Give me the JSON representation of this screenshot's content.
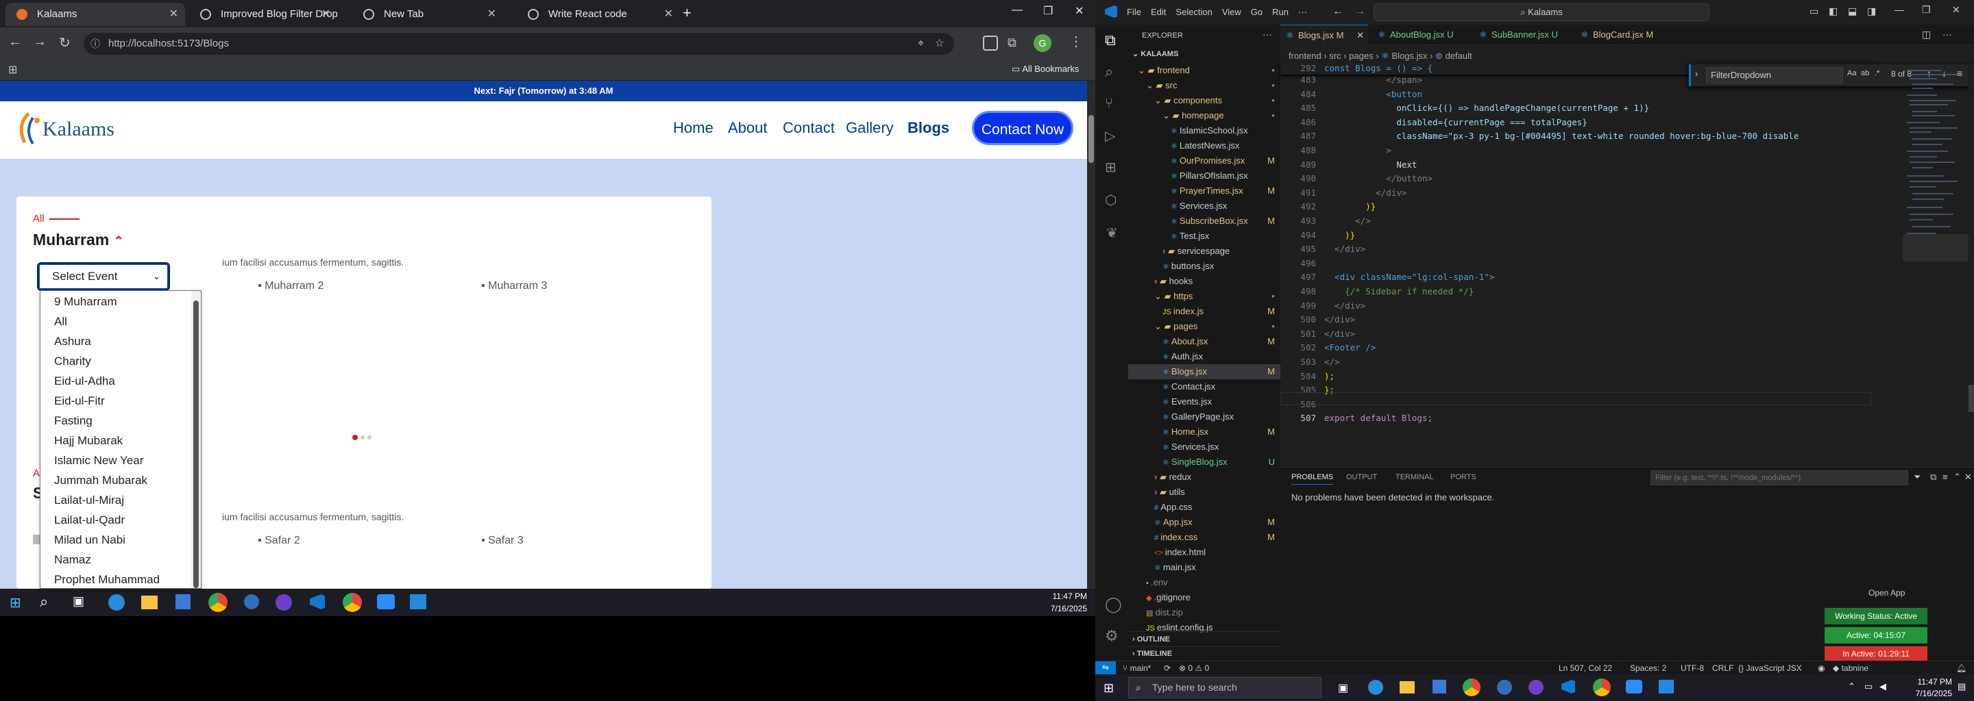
{
  "browser": {
    "tabs": [
      {
        "title": "Kalaams",
        "color": "#ef6c2e"
      },
      {
        "title": "Improved Blog Filter Dropdown",
        "color": "#c4c7c5"
      },
      {
        "title": "New Tab",
        "color": "#c4c7c5"
      },
      {
        "title": "Write React code",
        "color": "#c4c7c5"
      }
    ],
    "url": "http://localhost:5173/Blogs",
    "bookmarks_label": "All Bookmarks"
  },
  "site": {
    "notice": "Next: Fajr (Tomorrow) at 3:48 AM",
    "logo_text": "Kalaams",
    "nav": [
      "Home",
      "About",
      "Contact",
      "Gallery",
      "Blogs"
    ],
    "cta": "Contact Now",
    "category_tag": "All",
    "section_title": "Muharram",
    "select_value": "Select Event",
    "dropdown_options": [
      "9 Muharram",
      "All",
      "Ashura",
      "Charity",
      "Eid-ul-Adha",
      "Eid-ul-Fitr",
      "Fasting",
      "Hajj Mubarak",
      "Islamic New Year",
      "Jummah Mubarak",
      "Lailat-ul-Miraj",
      "Lailat-ul-Qadr",
      "Milad un Nabi",
      "Namaz",
      "Prophet Muhammad (PBUH)"
    ],
    "excerpt": "ium facilisi accusamus fermentum, sagittis.",
    "images_row1": [
      "Muharram 2",
      "Muharram 3"
    ],
    "second_tag": "A",
    "second_title": "S",
    "excerpt2": "ium facilisi accusamus fermentum, sagittis.",
    "images_row2": [
      "Safar 2",
      "Safar 3"
    ]
  },
  "win_taskbar_left": {
    "time": "11:47 PM",
    "date": "7/16/2025"
  },
  "vscode": {
    "menu": [
      "File",
      "Edit",
      "Selection",
      "View",
      "Go",
      "Run",
      "···"
    ],
    "search": "Kalaams",
    "explorer_title": "EXPLORER",
    "root": "KALAAMS",
    "tree": [
      {
        "name": "frontend",
        "depth": 0,
        "folder": true,
        "open": true,
        "dot": true
      },
      {
        "name": "src",
        "depth": 1,
        "folder": true,
        "open": true,
        "dot": true
      },
      {
        "name": "components",
        "depth": 2,
        "folder": true,
        "open": true,
        "dot": true
      },
      {
        "name": "homepage",
        "depth": 3,
        "folder": true,
        "open": true,
        "dot": true
      },
      {
        "name": "IslamicSchool.jsx",
        "depth": 4,
        "status": ""
      },
      {
        "name": "LatestNews.jsx",
        "depth": 4,
        "status": ""
      },
      {
        "name": "OurPromises.jsx",
        "depth": 4,
        "status": "M"
      },
      {
        "name": "PillarsOfIslam.jsx",
        "depth": 4,
        "status": ""
      },
      {
        "name": "PrayerTimes.jsx",
        "depth": 4,
        "status": "M"
      },
      {
        "name": "Services.jsx",
        "depth": 4,
        "status": ""
      },
      {
        "name": "SubscribeBox.jsx",
        "depth": 4,
        "status": "M"
      },
      {
        "name": "Test.jsx",
        "depth": 4,
        "status": ""
      },
      {
        "name": "servicespage",
        "depth": 3,
        "folder": true,
        "open": false
      },
      {
        "name": "buttons.jsx",
        "depth": 3,
        "status": ""
      },
      {
        "name": "hooks",
        "depth": 2,
        "folder": true,
        "open": false
      },
      {
        "name": "https",
        "depth": 2,
        "folder": true,
        "open": true,
        "dot": true
      },
      {
        "name": "index.js",
        "depth": 3,
        "status": "M"
      },
      {
        "name": "pages",
        "depth": 2,
        "folder": true,
        "open": true,
        "dot": true
      },
      {
        "name": "About.jsx",
        "depth": 3,
        "status": "M"
      },
      {
        "name": "Auth.jsx",
        "depth": 3,
        "status": ""
      },
      {
        "name": "Blogs.jsx",
        "depth": 3,
        "status": "M",
        "selected": true
      },
      {
        "name": "Contact.jsx",
        "depth": 3,
        "status": ""
      },
      {
        "name": "Events.jsx",
        "depth": 3,
        "status": ""
      },
      {
        "name": "GalleryPage.jsx",
        "depth": 3,
        "status": ""
      },
      {
        "name": "Home.jsx",
        "depth": 3,
        "status": "M"
      },
      {
        "name": "Services.jsx",
        "depth": 3,
        "status": ""
      },
      {
        "name": "SingleBlog.jsx",
        "depth": 3,
        "status": "U"
      },
      {
        "name": "redux",
        "depth": 2,
        "folder": true,
        "open": false
      },
      {
        "name": "utils",
        "depth": 2,
        "folder": true,
        "open": false
      },
      {
        "name": "App.css",
        "depth": 2,
        "status": ""
      },
      {
        "name": "App.jsx",
        "depth": 2,
        "status": "M"
      },
      {
        "name": "index.css",
        "depth": 2,
        "status": "M"
      },
      {
        "name": "index.html",
        "depth": 2,
        "status": ""
      },
      {
        "name": "main.jsx",
        "depth": 2,
        "status": ""
      },
      {
        "name": ".env",
        "depth": 1,
        "status": ""
      },
      {
        "name": ".gitignore",
        "depth": 1,
        "status": ""
      },
      {
        "name": "dist.zip",
        "depth": 1,
        "status": ""
      },
      {
        "name": "eslint.config.js",
        "depth": 1,
        "status": ""
      }
    ],
    "outline": "OUTLINE",
    "timeline": "TIMELINE",
    "editor_tabs": [
      {
        "name": "Blogs.jsx",
        "status": "M",
        "active": true
      },
      {
        "name": "AboutBlog.jsx",
        "status": "U"
      },
      {
        "name": "SubBanner.jsx",
        "status": "U"
      },
      {
        "name": "BlogCard.jsx",
        "status": "M"
      }
    ],
    "breadcrumb": [
      "frontend",
      "src",
      "pages",
      "Blogs.jsx",
      "default"
    ],
    "sticky_line": {
      "num": "292",
      "text": "const Blogs = () => {"
    },
    "find": {
      "query": "FilterDropdown",
      "result": "8 of 8"
    },
    "code": [
      {
        "n": "483",
        "t": "            </span>"
      },
      {
        "n": "484",
        "t": "            <button"
      },
      {
        "n": "485",
        "t": "              onClick={() => handlePageChange(currentPage + 1)}"
      },
      {
        "n": "486",
        "t": "              disabled={currentPage === totalPages}"
      },
      {
        "n": "487",
        "t": "              className=\"px-3 py-1 bg-[#004495] text-white rounded hover:bg-blue-700 disable"
      },
      {
        "n": "488",
        "t": "            >"
      },
      {
        "n": "489",
        "t": "              Next"
      },
      {
        "n": "490",
        "t": "            </button>"
      },
      {
        "n": "491",
        "t": "          </div>"
      },
      {
        "n": "492",
        "t": "        )}"
      },
      {
        "n": "493",
        "t": "      </>"
      },
      {
        "n": "494",
        "t": "    )}"
      },
      {
        "n": "495",
        "t": "  </div>"
      },
      {
        "n": "496",
        "t": ""
      },
      {
        "n": "497",
        "t": "  <div className=\"lg:col-span-1\">"
      },
      {
        "n": "498",
        "t": "    {/* Sidebar if needed */}"
      },
      {
        "n": "499",
        "t": "  </div>"
      },
      {
        "n": "500",
        "t": "</div>"
      },
      {
        "n": "501",
        "t": "</div>"
      },
      {
        "n": "502",
        "t": "<Footer />"
      },
      {
        "n": "503",
        "t": "</>"
      },
      {
        "n": "504",
        "t": ");"
      },
      {
        "n": "505",
        "t": "};"
      },
      {
        "n": "506",
        "t": ""
      },
      {
        "n": "507",
        "t": "export default Blogs;"
      }
    ],
    "panel_tabs": [
      "PROBLEMS",
      "OUTPUT",
      "TERMINAL",
      "PORTS"
    ],
    "filter_placeholder": "Filter (e.g. text, **/*.ts, !**/node_modules/**)",
    "problems_msg": "No problems have been detected in the workspace.",
    "status": {
      "branch": "main*",
      "problems": "⊗ 0 ⚠ 0",
      "position": "Ln 507, Col 22",
      "spaces": "Spaces: 2",
      "encoding": "UTF-8",
      "eol": "CRLF",
      "lang": "JavaScript JSX",
      "extra": "tabnine"
    },
    "widgets": {
      "open_app": "Open App",
      "working": "Working Status: Active",
      "active": "Active: 04:15:07",
      "inactive": "In Active: 01:29:11"
    }
  },
  "win_taskbar_right": {
    "search": "Type here to search",
    "time": "11:47 PM",
    "date": "7/16/2025"
  }
}
